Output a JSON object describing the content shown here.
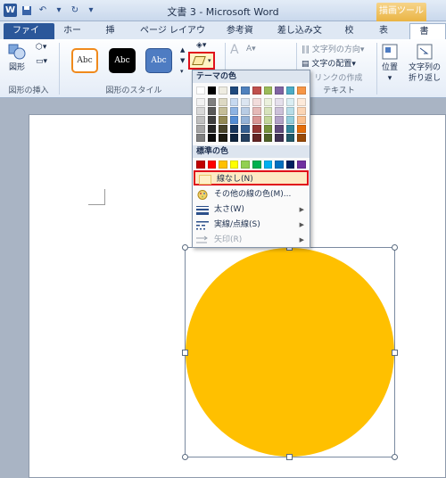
{
  "window": {
    "title": "文書 3 - Microsoft Word",
    "contextual_tab": "描画ツール"
  },
  "qat": {
    "app_icon": "W"
  },
  "tabs": [
    "ファイル",
    "ホーム",
    "挿入",
    "ページ レイアウト",
    "参考資料",
    "差し込み文書",
    "校閲",
    "表示",
    "書式"
  ],
  "ribbon": {
    "insert_shapes": {
      "shapes_label": "図形",
      "group_label": "図形の挿入"
    },
    "shape_styles": {
      "style_text": "Abc",
      "group_label": "図形のスタイル"
    },
    "text_group": {
      "direction": "文字列の方向",
      "align": "文字の配置",
      "link": "リンクの作成",
      "group_label": "テキスト"
    },
    "arrange": {
      "position": "位置",
      "wrap_line1": "文字列の",
      "wrap_line2": "折り返し"
    }
  },
  "dropdown": {
    "theme_colors_label": "テーマの色",
    "standard_colors_label": "標準の色",
    "no_outline": "線なし(N)",
    "more_colors": "その他の線の色(M)...",
    "weight": "太さ(W)",
    "dashes": "実線/点線(S)",
    "arrows": "矢印(R)"
  },
  "colors": {
    "accent_red": "#e0101b",
    "shape_fill": "#ffc000",
    "file_tab": "#2b579a"
  }
}
